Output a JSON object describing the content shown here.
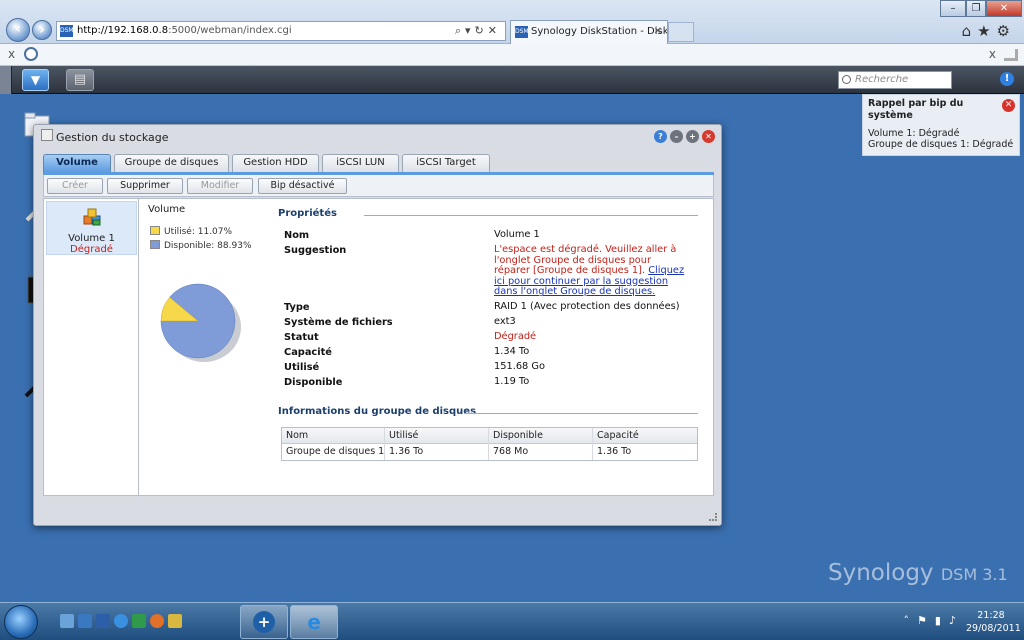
{
  "browser": {
    "address_host": "http://192.168.0.8",
    "address_path": ":5000/webman/index.cgi",
    "tab_title": "Synology DiskStation - Disk...",
    "favicon_text": "DSM",
    "window_controls": [
      "–",
      "❐",
      "✕"
    ]
  },
  "dsm": {
    "search_placeholder": "Recherche"
  },
  "notification": {
    "title": "Rappel par bip du système",
    "lines": [
      "Volume 1: Dégradé",
      "Groupe de disques 1: Dégradé"
    ]
  },
  "window": {
    "title": "Gestion du stockage",
    "tabs": [
      "Volume",
      "Groupe de disques",
      "Gestion HDD",
      "iSCSI LUN",
      "iSCSI Target"
    ],
    "toolbar": [
      "Créer",
      "Supprimer",
      "Modifier",
      "Bip désactivé"
    ],
    "volume_item": {
      "name": "Volume 1",
      "status": "Dégradé"
    },
    "mid": {
      "title": "Volume",
      "legend_used": "Utilisé: 11.07%",
      "legend_avail": "Disponible: 88.93%",
      "used_fraction": 0.1107
    },
    "properties": {
      "section_title": "Propriétés",
      "rows": [
        {
          "label": "Nom",
          "value": "Volume 1"
        },
        {
          "label": "Suggestion",
          "value": "L'espace est dégradé. Veuillez aller à l'onglet Groupe de disques pour réparer [Groupe de disques 1].",
          "link": "Cliquez ici pour continuer par la suggestion dans l'onglet Groupe de disques."
        },
        {
          "label": "Type",
          "value": "RAID 1 (Avec protection des données)"
        },
        {
          "label": "Système de fichiers",
          "value": "ext3"
        },
        {
          "label": "Statut",
          "value": "Dégradé"
        },
        {
          "label": "Capacité",
          "value": "1.34 To"
        },
        {
          "label": "Utilisé",
          "value": "151.68 Go"
        },
        {
          "label": "Disponible",
          "value": "1.19 To"
        }
      ]
    },
    "group_info": {
      "section_title": "Informations du groupe de disques",
      "headers": [
        "Nom",
        "Utilisé",
        "Disponible",
        "Capacité"
      ],
      "rows": [
        [
          "Groupe de disques 1",
          "1.36 To",
          "768 Mo",
          "1.36 To"
        ]
      ]
    }
  },
  "desktop": {
    "watermark": "Synology",
    "watermark_suffix": "DSM 3.1"
  },
  "taskbar": {
    "time": "21:28",
    "date": "29/08/2011"
  },
  "colors": {
    "degraded": "#c2221a",
    "used_slice": "#f7d84a",
    "avail_slice": "#7f9cd8",
    "active_tab": "#5d9be0"
  }
}
